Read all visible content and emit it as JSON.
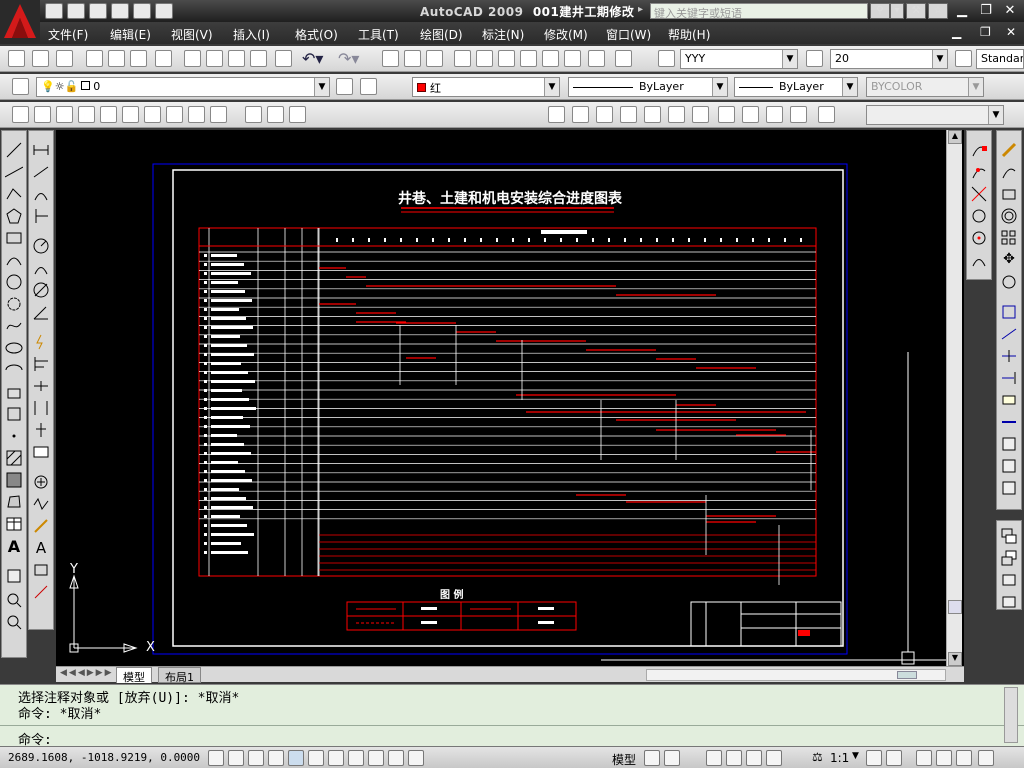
{
  "app": {
    "name": "AutoCAD 2009",
    "document": "001建井工期修改"
  },
  "search": {
    "placeholder": "键入关键字或短语"
  },
  "menu": {
    "items": [
      {
        "label": "文件(F)"
      },
      {
        "label": "编辑(E)"
      },
      {
        "label": "视图(V)"
      },
      {
        "label": "插入(I)"
      },
      {
        "label": "格式(O)"
      },
      {
        "label": "工具(T)"
      },
      {
        "label": "绘图(D)"
      },
      {
        "label": "标注(N)"
      },
      {
        "label": "修改(M)"
      },
      {
        "label": "窗口(W)"
      },
      {
        "label": "帮助(H)"
      }
    ]
  },
  "toolbar": {
    "text_style": "YYY",
    "text_height": "20",
    "dim_style": "Standar",
    "layer": "0",
    "color": "红",
    "color_hex": "#ff0000",
    "linetype": "ByLayer",
    "lineweight": "ByLayer",
    "plotstyle": "BYCOLOR"
  },
  "drawing": {
    "title": "井巷、土建和机电安装综合进度图表",
    "legend_title": "图 例",
    "axis_x": "X",
    "axis_y": "Y"
  },
  "tabs": {
    "model": "模型",
    "layout1": "布局1"
  },
  "command": {
    "line1": "选择注释对象或 [放弃(U)]: *取消*",
    "line2": "命令: *取消*",
    "prompt": "命令:"
  },
  "status": {
    "coords": "2689.1608, -1018.9219, 0.0000",
    "space": "模型",
    "annotation_scale": "1:1"
  },
  "colors": {
    "background": "#000000",
    "red": "#ff0000",
    "border_blue": "#0000ff",
    "cmd_bg": "#e2eedd"
  }
}
